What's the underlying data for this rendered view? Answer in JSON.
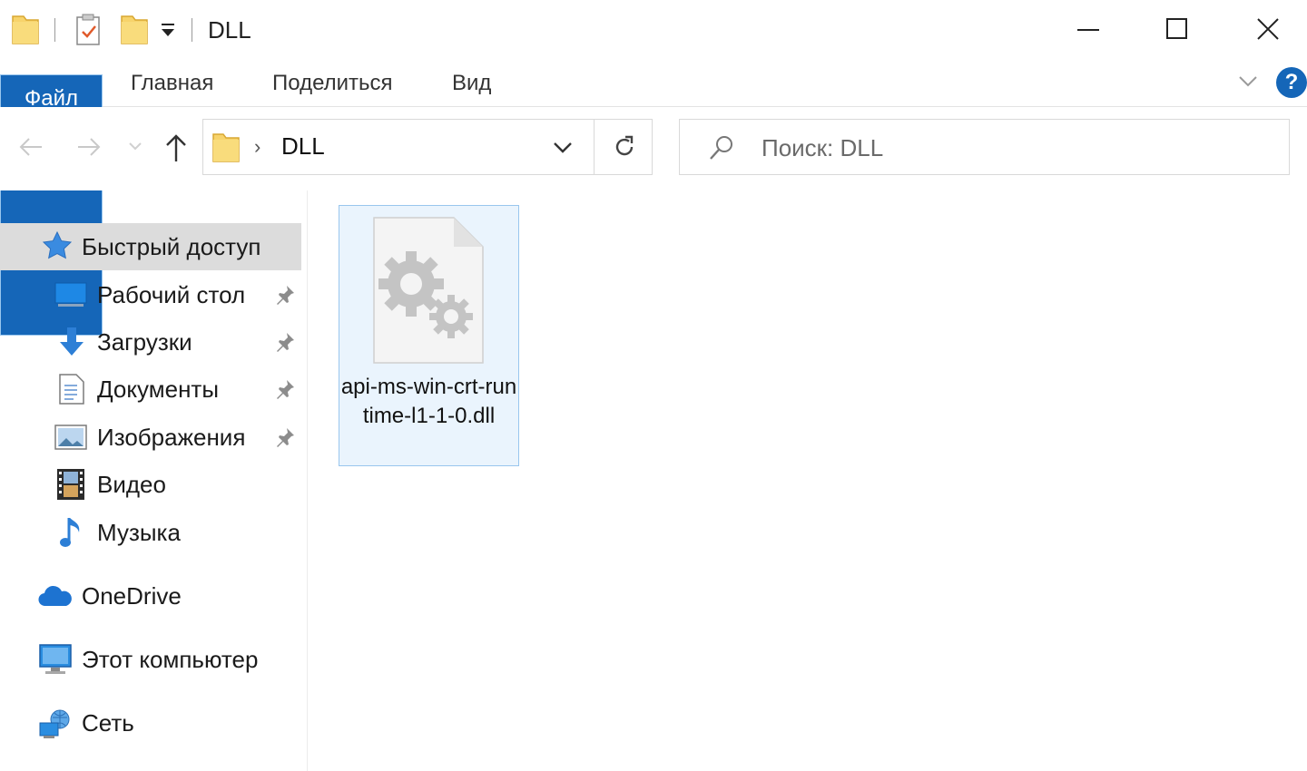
{
  "window": {
    "title": "DLL",
    "minimize": "—",
    "maximize": "☐",
    "close": "✕"
  },
  "ribbon": {
    "tabs": [
      {
        "label": "Файл"
      },
      {
        "label": "Главная"
      },
      {
        "label": "Поделиться"
      },
      {
        "label": "Вид"
      }
    ],
    "help": "?"
  },
  "address": {
    "path": "DLL",
    "separator": "›"
  },
  "search": {
    "placeholder": "Поиск: DLL"
  },
  "sidebar": {
    "quick_access": "Быстрый доступ",
    "items": [
      {
        "label": "Рабочий стол",
        "icon": "desktop-icon"
      },
      {
        "label": "Загрузки",
        "icon": "downloads-icon"
      },
      {
        "label": "Документы",
        "icon": "documents-icon"
      },
      {
        "label": "Изображения",
        "icon": "pictures-icon"
      },
      {
        "label": "Видео",
        "icon": "video-icon"
      },
      {
        "label": "Музыка",
        "icon": "music-icon"
      }
    ],
    "onedrive": "OneDrive",
    "this_pc": "Этот компьютер",
    "network": "Сеть"
  },
  "files": [
    {
      "name": "api-ms-win-crt-runtime-l1-1-0.dll",
      "icon": "dll-file-icon"
    }
  ],
  "colors": {
    "accent": "#1566b8",
    "selection": "#eaf4fd",
    "selection_border": "#99c6ee",
    "folder": "#f5c94c"
  }
}
